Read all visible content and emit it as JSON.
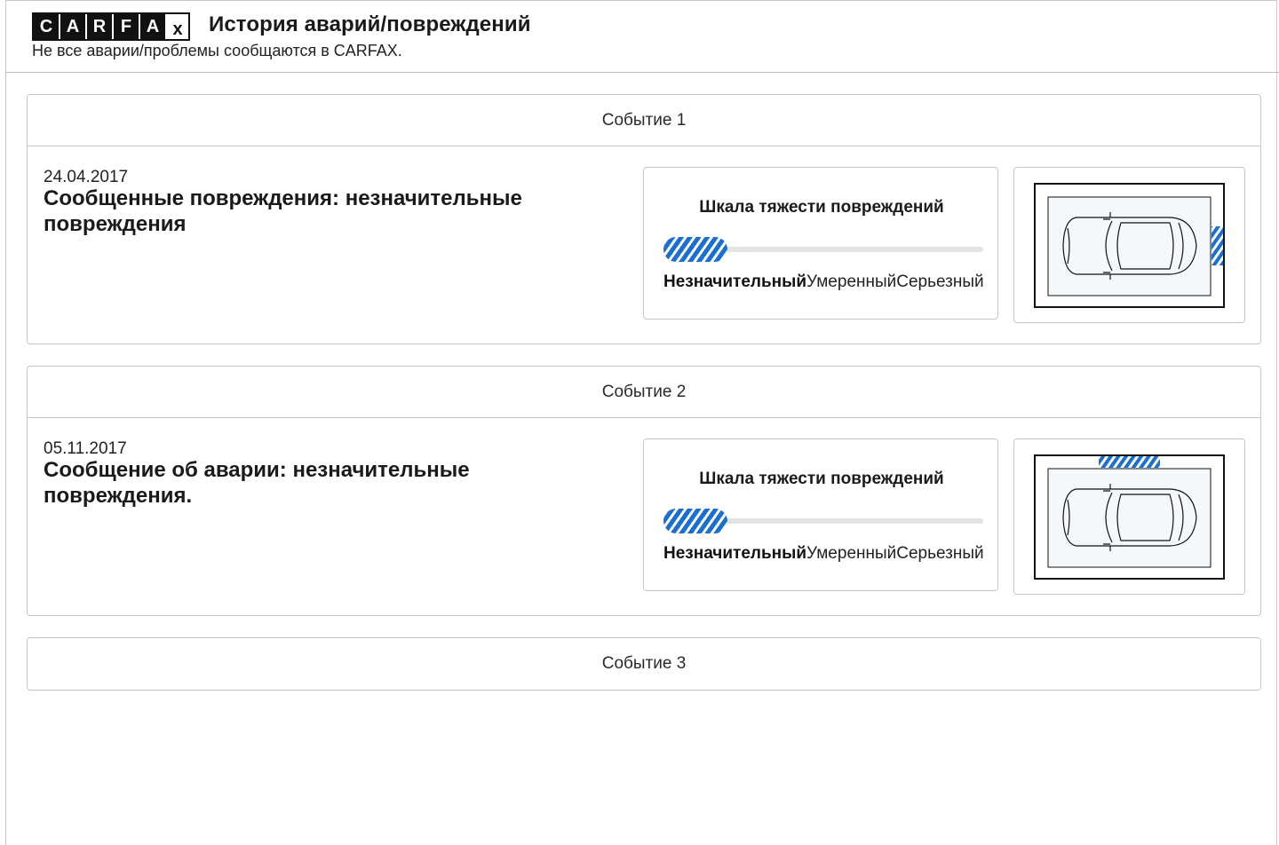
{
  "header": {
    "logo_letters": [
      "C",
      "A",
      "R",
      "F",
      "A",
      "x"
    ],
    "title": "История аварий/повреждений",
    "subtitle": "Не все аварии/проблемы сообщаются в CARFAX."
  },
  "severity_scale_title": "Шкала тяжести повреждений",
  "severity_levels": [
    "Незначительный",
    "Умеренный",
    "Серьезный"
  ],
  "colors": {
    "accent": "#1a6fcf",
    "border": "#c6c6c6",
    "car_area": "#f5f8fb"
  },
  "events": [
    {
      "label": "Событие 1",
      "date": "24.04.2017",
      "description": "Сообщенные повреждения: незначительные повреждения",
      "severity": "Незначительный",
      "severity_fill": 0.2,
      "damage_location": "right",
      "icon": "car-top-view-icon"
    },
    {
      "label": "Событие 2",
      "date": "05.11.2017",
      "description": "Сообщение об аварии: незначительные повреждения.",
      "severity": "Незначительный",
      "severity_fill": 0.2,
      "damage_location": "top",
      "icon": "car-top-view-icon"
    },
    {
      "label": "Событие 3"
    }
  ]
}
